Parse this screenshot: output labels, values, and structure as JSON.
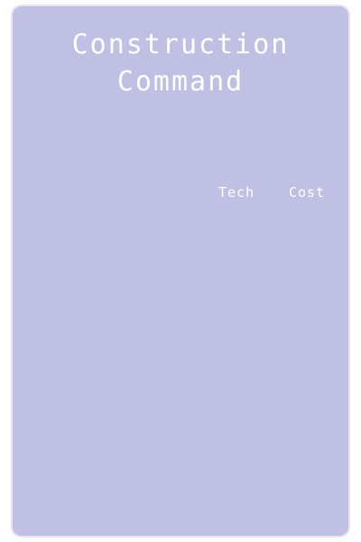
{
  "panel": {
    "title_line1": "Construction",
    "title_line2": "Command",
    "columns": {
      "tech": "Tech",
      "cost": "Cost"
    }
  },
  "colors": {
    "panel_background": "#c0c0e4",
    "panel_border": "#e4e4f4",
    "text": "#ffffff"
  }
}
